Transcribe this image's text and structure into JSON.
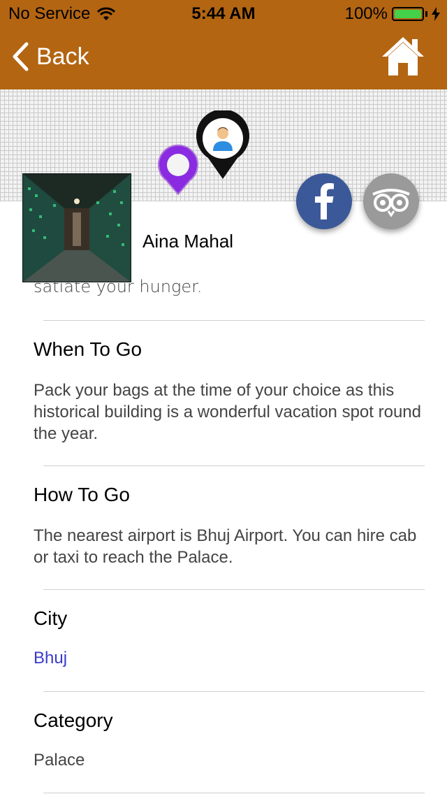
{
  "status_bar": {
    "carrier": "No Service",
    "time": "5:44 AM",
    "battery": "100%",
    "colors": {
      "bar": "#b36512",
      "battery_fill": "#43d14a"
    }
  },
  "nav": {
    "back_label": "Back"
  },
  "place": {
    "name": "Aina Mahal",
    "snippet": "satiate your hunger."
  },
  "sections": {
    "when": {
      "title": "When To Go",
      "body": "Pack your bags at the time of your choice as this historical building is a wonderful vacation spot round the year."
    },
    "how": {
      "title": "How To Go",
      "body": "The nearest airport is Bhuj Airport. You can hire cab or taxi to reach the Palace."
    },
    "city": {
      "title": "City",
      "value": "Bhuj"
    },
    "category": {
      "title": "Category",
      "value": "Palace"
    }
  },
  "icons": {
    "back": "chevron-left-icon",
    "home": "home-icon",
    "wifi": "wifi-icon",
    "charging": "bolt-icon",
    "place_pin": "map-pin-icon",
    "user_pin": "user-location-pin-icon",
    "facebook": "facebook-icon",
    "tripadvisor": "owl-icon"
  },
  "colors": {
    "brand": "#b36512",
    "facebook": "#3b5998",
    "link": "#3a3acc",
    "pin_purple": "#8a2be2"
  }
}
